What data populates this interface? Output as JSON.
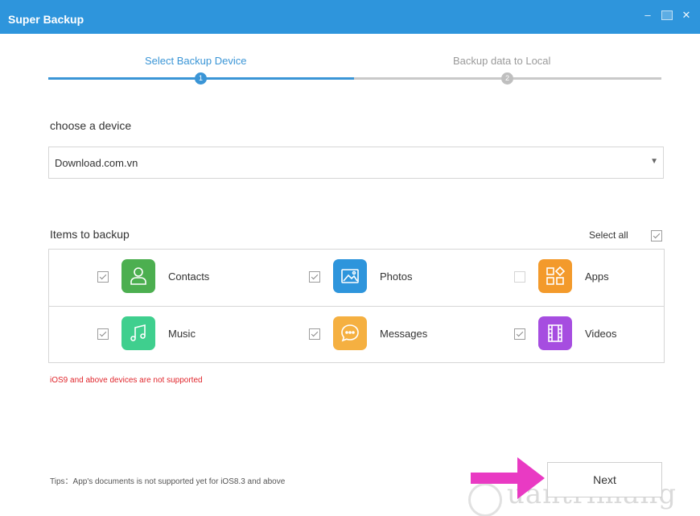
{
  "window": {
    "title": "Super Backup",
    "controls": [
      "minimize",
      "maximize",
      "close"
    ],
    "minimize_glyph": "–",
    "close_glyph": "✕"
  },
  "steps": [
    {
      "label": "Select Backup Device",
      "number": "1",
      "active": true
    },
    {
      "label": "Backup data to Local",
      "number": "2",
      "active": false
    }
  ],
  "device": {
    "label": "choose a device",
    "selected": "Download.com.vn",
    "caret": "▼"
  },
  "items": {
    "label": "Items to backup",
    "select_all_label": "Select all",
    "select_all_checked": true,
    "list": [
      {
        "name": "Contacts",
        "checked": true,
        "icon": "person-icon",
        "color": "#4caf50"
      },
      {
        "name": "Photos",
        "checked": true,
        "icon": "image-icon",
        "color": "#2e95dc"
      },
      {
        "name": "Apps",
        "checked": false,
        "icon": "apps-grid-icon",
        "color": "#f39a2b"
      },
      {
        "name": "Music",
        "checked": true,
        "icon": "music-note-icon",
        "color": "#3fcf8e"
      },
      {
        "name": "Messages",
        "checked": true,
        "icon": "chat-bubble-icon",
        "color": "#f5b041"
      },
      {
        "name": "Videos",
        "checked": true,
        "icon": "film-icon",
        "color": "#a64de0"
      }
    ]
  },
  "warning": "iOS9 and above devices are not supported",
  "tips": "Tips：App's documents is not supported yet for iOS8.3 and above",
  "next_label": "Next",
  "annotation_arrow_color": "#e93ac3",
  "watermark": "uantrimang",
  "colors": {
    "accent": "#2e95dc",
    "step_active": "#3a95d6",
    "step_inactive": "#c9c9c9",
    "warning": "#e0262c"
  }
}
